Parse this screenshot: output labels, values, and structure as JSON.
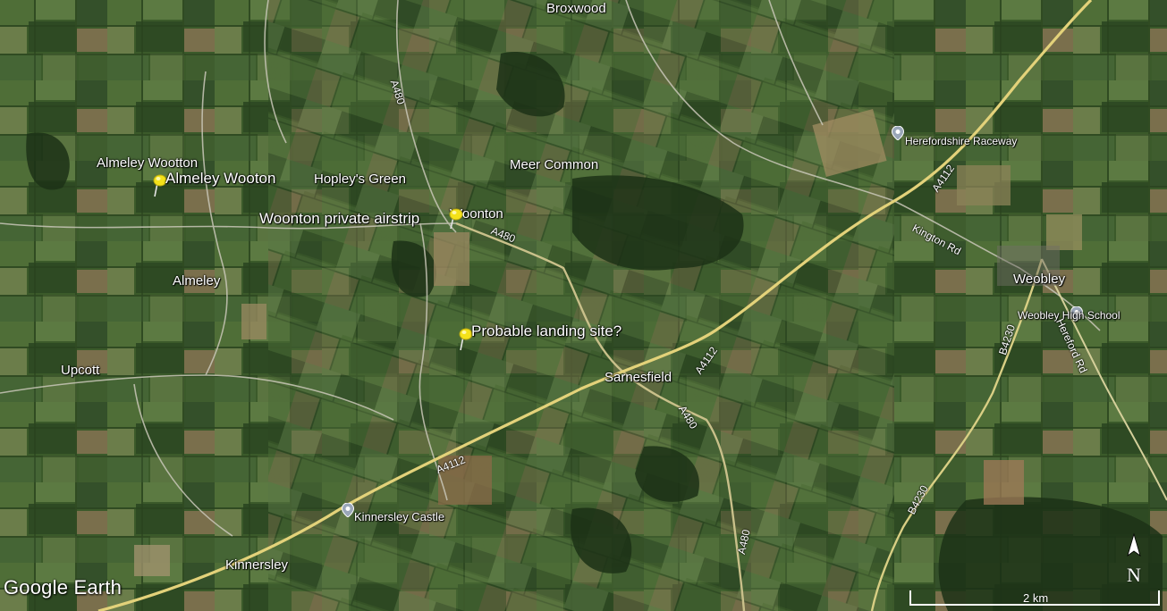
{
  "map": {
    "colors": {
      "field_dark": "#2f4a22",
      "field_mid": "#4c6a36",
      "field_light": "#6d8a4e",
      "field_brown": "#8a7550",
      "forest": "#1e3318",
      "road_main": "#e3d27a",
      "road_minor": "#c9c7b8"
    },
    "places": [
      {
        "id": "broxwood",
        "text": "Broxwood"
      },
      {
        "id": "almeley-wootton",
        "text": "Almeley Wootton"
      },
      {
        "id": "hopleys-green",
        "text": "Hopley's Green"
      },
      {
        "id": "meer-common",
        "text": "Meer Common"
      },
      {
        "id": "woonton",
        "text": "Woonton"
      },
      {
        "id": "almeley",
        "text": "Almeley"
      },
      {
        "id": "upcott",
        "text": "Upcott"
      },
      {
        "id": "sarnesfield",
        "text": "Sarnesfield"
      },
      {
        "id": "kinnersley",
        "text": "Kinnersley"
      },
      {
        "id": "weobley",
        "text": "Weobley"
      },
      {
        "id": "herefordshire-raceway",
        "text": "Herefordshire Raceway"
      },
      {
        "id": "weobley-high-school",
        "text": "Weobley High School"
      },
      {
        "id": "kinnersley-castle",
        "text": "Kinnersley Castle"
      }
    ],
    "pins": [
      {
        "id": "almeley-wooton",
        "text": "Almeley Wooton",
        "icon": "yellow-pushpin-icon"
      },
      {
        "id": "woonton-airstrip",
        "text": "Woonton private airstrip",
        "icon": "yellow-pushpin-icon"
      },
      {
        "id": "landing-site",
        "text": "Probable landing site?",
        "icon": "yellow-pushpin-icon"
      }
    ],
    "roads": {
      "a480_north": "A480",
      "a480_woonton": "A480",
      "a480_south1": "A480",
      "a480_south2": "A480",
      "a4112_west": "A4112",
      "a4112_mid": "A4112",
      "a4112_east": "A4112",
      "b4230_north": "B4230",
      "b4230_south": "B4230",
      "kington_rd": "Kington Rd",
      "hereford_rd": "Hereford Rd"
    },
    "brand": "Google Earth",
    "compass": {
      "letter": "N",
      "icon": "north-arrow-icon"
    },
    "scale": {
      "label": "2 km"
    }
  }
}
